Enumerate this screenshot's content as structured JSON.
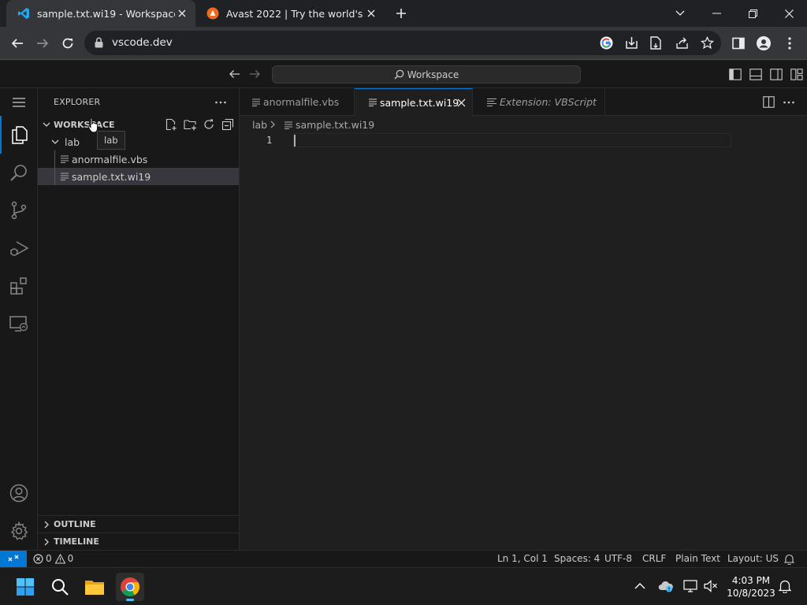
{
  "browser": {
    "tabs": [
      {
        "title": "sample.txt.wi19 - Workspace - V",
        "icon": "vscode-icon",
        "active": true
      },
      {
        "title": "Avast 2022 | Try the world's mos",
        "icon": "avast-icon",
        "active": false
      }
    ],
    "url": "vscode.dev"
  },
  "vscode": {
    "command_center": "Workspace",
    "explorer": {
      "title": "EXPLORER",
      "workspace": "WORKSPACE",
      "folder": "lab",
      "files": [
        "anormalfile.vbs",
        "sample.txt.wi19"
      ],
      "tooltip": "lab",
      "outline": "OUTLINE",
      "timeline": "TIMELINE"
    },
    "editor_tabs": [
      {
        "label": "anormalfile.vbs",
        "active": false,
        "italic": false
      },
      {
        "label": "sample.txt.wi19",
        "active": true,
        "italic": false
      },
      {
        "label": "Extension: VBScript",
        "active": false,
        "italic": true
      }
    ],
    "breadcrumb": {
      "folder": "lab",
      "file": "sample.txt.wi19"
    },
    "line_number": "1",
    "status": {
      "errors": "0",
      "warnings": "0",
      "position": "Ln 1, Col 1",
      "spaces": "Spaces: 4",
      "encoding": "UTF-8",
      "eol": "CRLF",
      "language": "Plain Text",
      "layout": "Layout: US"
    }
  },
  "taskbar": {
    "time": "4:03 PM",
    "date": "10/8/2023"
  },
  "colors": {
    "accent": "#0078d4",
    "editor_bg": "#1f1f1f",
    "sidebar_bg": "#181818"
  }
}
